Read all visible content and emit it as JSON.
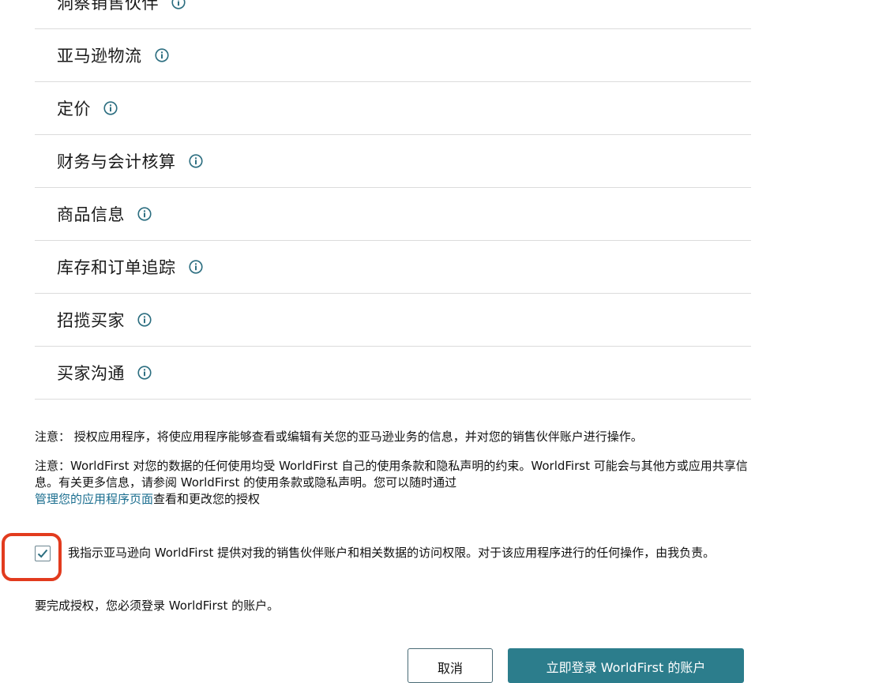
{
  "permissions": [
    {
      "label": "洞察销售伙伴"
    },
    {
      "label": "亚马逊物流"
    },
    {
      "label": "定价"
    },
    {
      "label": "财务与会计核算"
    },
    {
      "label": "商品信息"
    },
    {
      "label": "库存和订单追踪"
    },
    {
      "label": "招揽买家"
    },
    {
      "label": "买家沟通"
    }
  ],
  "notes": {
    "note1": "注意： 授权应用程序，将使应用程序能够查看或编辑有关您的亚马逊业务的信息，并对您的销售伙伴账户进行操作。",
    "note2_text": "注意：WorldFirst 对您的数据的任何使用均受 WorldFirst 自己的使用条款和隐私声明的约束。WorldFirst 可能会与其他方或应用共享信息。有关更多信息，请参阅 WorldFirst 的使用条款或隐私声明。您可以随时通过",
    "note2_link": "管理您的应用程序页面",
    "note2_suffix": "查看和更改您的授权"
  },
  "consent": {
    "checked": true,
    "text": "我指示亚马逊向 WorldFirst 提供对我的销售伙伴账户和相关数据的访问权限。对于该应用程序进行的任何操作，由我负责。"
  },
  "login_requirement": "要完成授权，您必须登录 WorldFirst 的账户。",
  "buttons": {
    "cancel": "取消",
    "login": "立即登录 WorldFirst 的账户"
  },
  "colors": {
    "accent": "#2c7d8c",
    "link": "#1b6e8f",
    "highlight": "#e23b1e"
  }
}
